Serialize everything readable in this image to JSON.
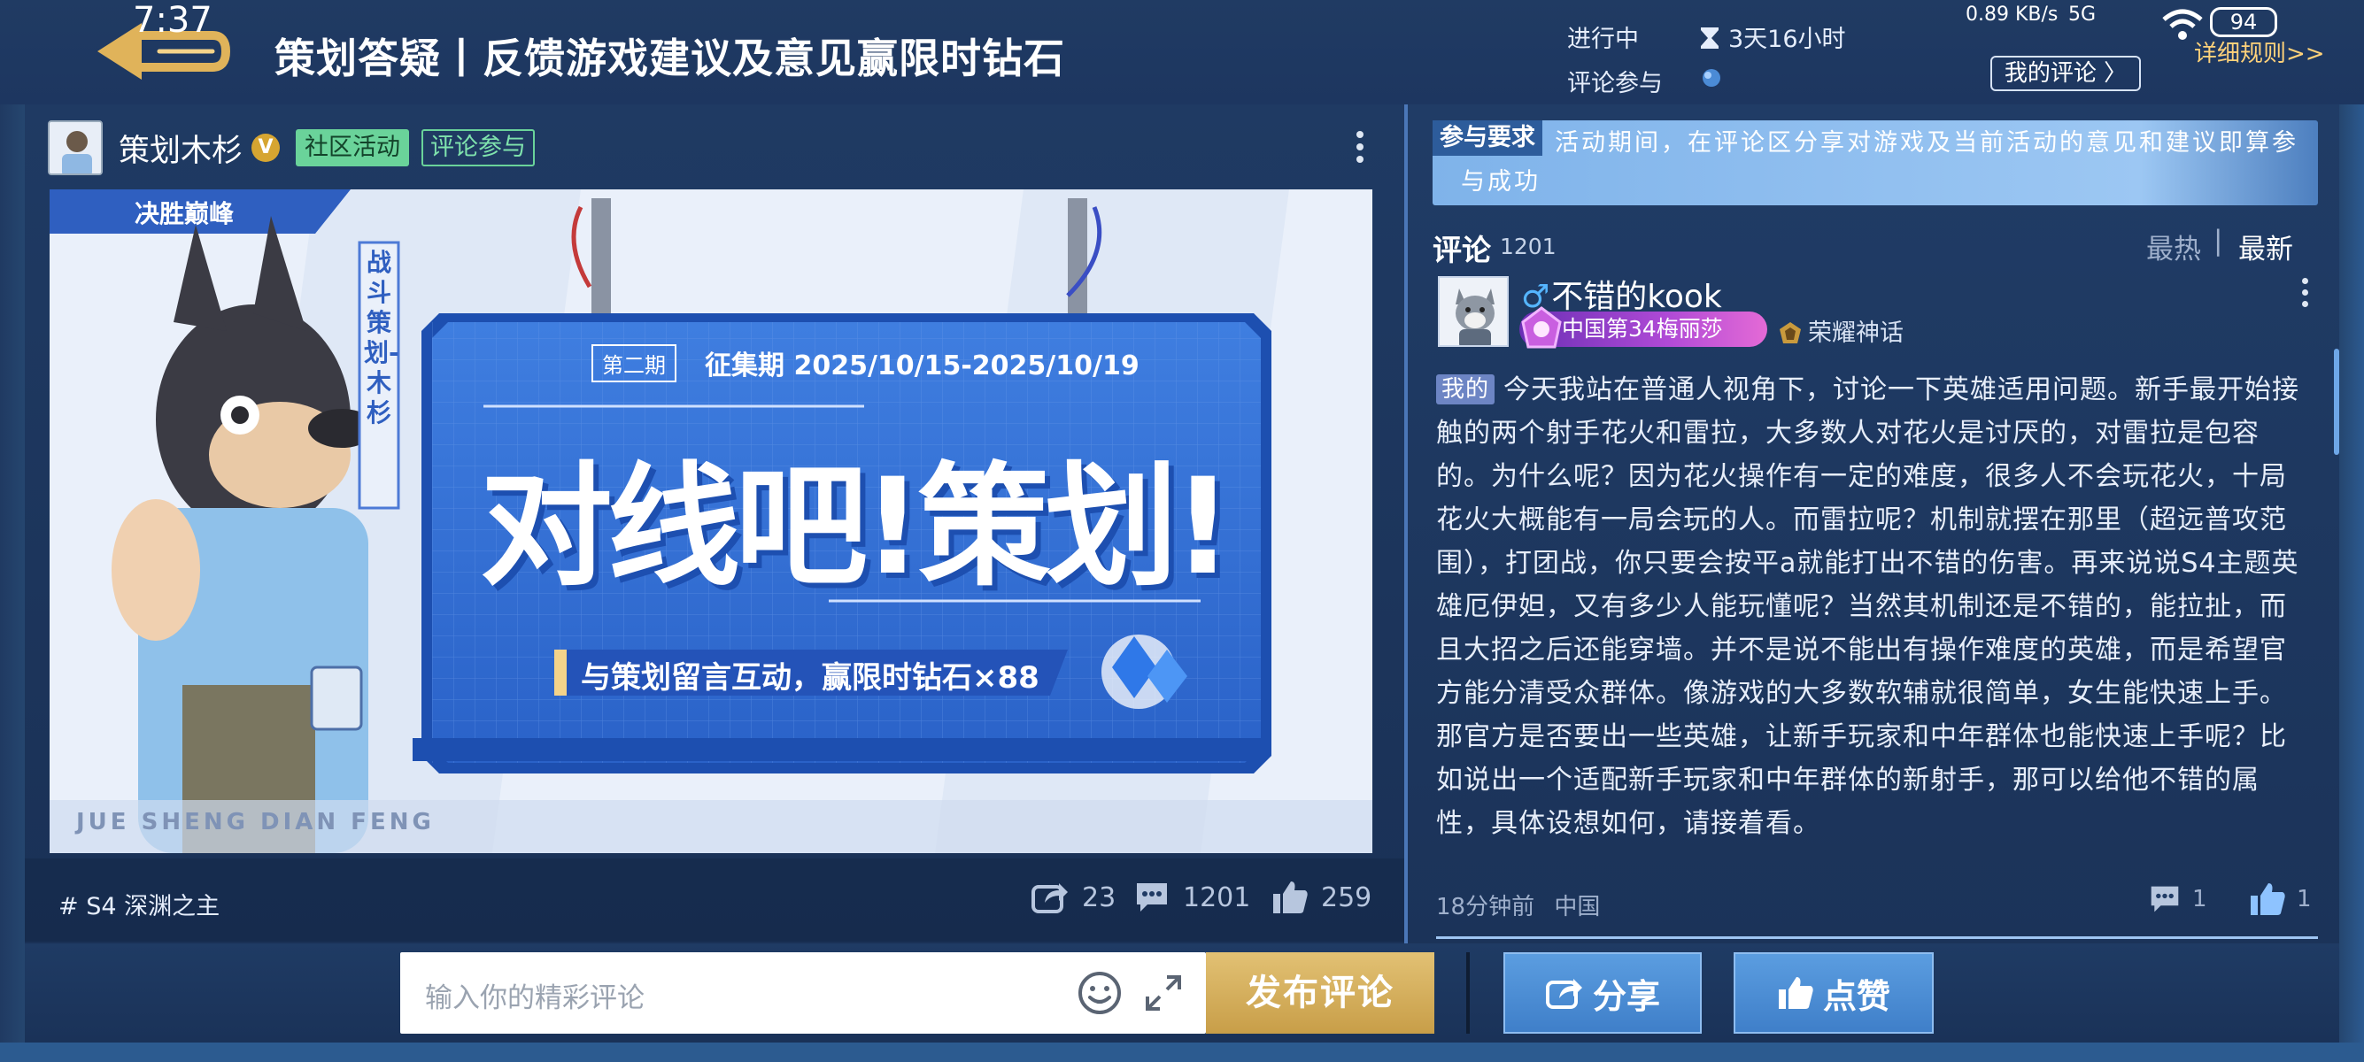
{
  "status_bar": {
    "time": "7:37",
    "network": "0.89 KB/s",
    "signal": "5G",
    "battery": "94"
  },
  "header": {
    "title": "策划答疑丨反馈游戏建议及意见赢限时钻石",
    "status_label": "进行中",
    "time_remaining": "3天16小时",
    "participation_label": "评论参与",
    "my_comment_button": "我的评论 〉",
    "rules_link": "详细规则>>"
  },
  "post": {
    "author": "策划木杉",
    "verified_badge": "V",
    "tags": [
      "社区活动",
      "评论参与"
    ],
    "banner": {
      "brand": "决胜巅峰",
      "vertical_label": "战斗策划-木杉",
      "issue_tag": "第二期",
      "period": "征集期 2025/10/15-2025/10/19",
      "headline": "对线吧!策划!",
      "subline": "与策划留言互动，赢限时钻石×88",
      "watermark": "JUE SHENG DIAN FENG"
    },
    "hashtag": "# S4 深渊之主",
    "share_count": "23",
    "comment_count": "1201",
    "like_count": "259"
  },
  "requirements": {
    "tag": "参与要求",
    "text": "活动期间，在评论区分享对游戏及当前活动的意见和建议即算参与成功"
  },
  "comments": {
    "label": "评论",
    "count": "1201",
    "sort_hot": "最热",
    "sort_sep": "|",
    "sort_new": "最新",
    "items": [
      {
        "gender": "♂",
        "username": "不错的kook",
        "rank": "中国第34梅丽莎",
        "honor": "荣耀神话",
        "mine_tag": "我的",
        "body": "今天我站在普通人视角下，讨论一下英雄适用问题。新手最开始接触的两个射手花火和雷拉，大多数人对花火是讨厌的，对雷拉是包容的。为什么呢？因为花火操作有一定的难度，很多人不会玩花火，十局花火大概能有一局会玩的人。而雷拉呢？机制就摆在那里（超远普攻范围），打团战，你只要会按平a就能打出不错的伤害。再来说说S4主题英雄厄伊妲，又有多少人能玩懂呢？当然其机制还是不错的，能拉扯，而且大招之后还能穿墙。并不是说不能出有操作难度的英雄，而是希望官方能分清受众群体。像游戏的大多数软辅就很简单，女生能快速上手。那官方是否要出一些英雄，让新手玩家和中年群体也能快速上手呢？比如说出一个适配新手玩家和中年群体的新射手，那可以给他不错的属性，具体设想如何，请接着看。",
        "time": "18分钟前",
        "location": "中国",
        "reply_count": "1",
        "like_count": "1"
      }
    ]
  },
  "composer": {
    "placeholder": "输入你的精彩评论",
    "submit_label": "发布评论",
    "share_label": "分享",
    "like_label": "点赞"
  },
  "colors": {
    "accent_gold": "#c89e48",
    "tag_green": "#6ad39a",
    "panel_bg": "#1f3a63",
    "link_gold": "#ffd27a"
  }
}
